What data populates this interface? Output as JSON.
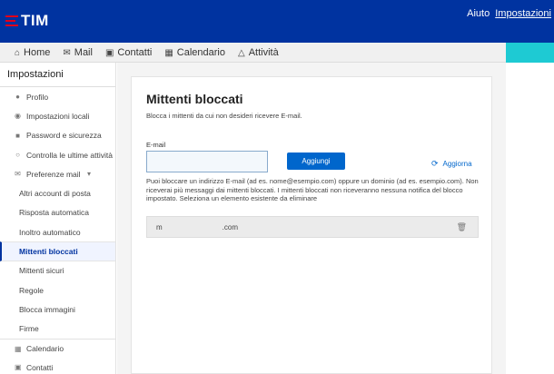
{
  "header": {
    "logo_text": "TIM",
    "links": {
      "help": "Aiuto",
      "settings": "Impostazioni"
    },
    "brand_color": "#0033a0",
    "logo_accent": "#e2001a",
    "teal_accent": "#1ecad3"
  },
  "nav": {
    "items": [
      {
        "label": "Home",
        "icon": "home-icon"
      },
      {
        "label": "Mail",
        "icon": "mail-icon"
      },
      {
        "label": "Contatti",
        "icon": "contacts-icon"
      },
      {
        "label": "Calendario",
        "icon": "calendar-icon"
      },
      {
        "label": "Attività",
        "icon": "bell-icon"
      }
    ]
  },
  "sidebar": {
    "title": "Impostazioni",
    "items": [
      {
        "label": "Profilo",
        "icon": "user-icon"
      },
      {
        "label": "Impostazioni locali",
        "icon": "location-icon"
      },
      {
        "label": "Password e sicurezza",
        "icon": "lock-icon"
      },
      {
        "label": "Controlla le ultime attività",
        "icon": "circle-icon"
      },
      {
        "label": "Preferenze mail",
        "icon": "mail-icon"
      },
      {
        "label": "Altri account di posta"
      },
      {
        "label": "Risposta automatica"
      },
      {
        "label": "Inoltro automatico"
      },
      {
        "label": "Mittenti bloccati"
      },
      {
        "label": "Mittenti sicuri"
      },
      {
        "label": "Regole"
      },
      {
        "label": "Blocca immagini"
      },
      {
        "label": "Firme"
      },
      {
        "label": "Calendario",
        "icon": "calendar-icon"
      },
      {
        "label": "Contatti",
        "icon": "contacts-icon"
      }
    ]
  },
  "main": {
    "title": "Mittenti bloccati",
    "subtitle": "Blocca i mittenti da cui non desideri ricevere E-mail.",
    "email_label": "E-mail",
    "email_value": "",
    "add_button": "Aggiungi",
    "refresh_label": "Aggiorna",
    "help_text": "Puoi bloccare un indirizzo E-mail (ad es. nome@esempio.com) oppure un dominio (ad es. esempio.com). Non riceverai più messaggi dai mittenti bloccati. I mittenti bloccati non riceveranno nessuna notifica del blocco impostato. Seleziona un elemento esistente da eliminare",
    "blocked": [
      {
        "prefix": "m",
        "suffix": ".com"
      }
    ]
  }
}
